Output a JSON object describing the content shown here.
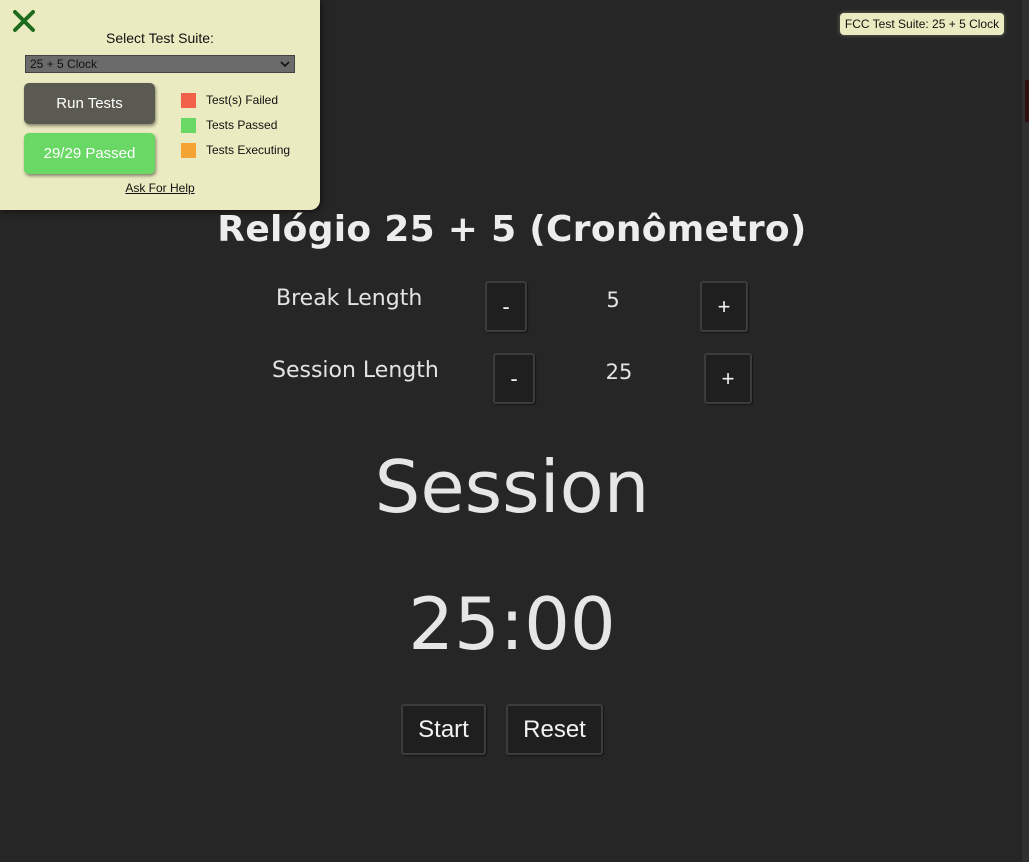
{
  "fcc_panel": {
    "close_icon": "close-x-icon",
    "select_label": "Select Test Suite:",
    "selected_suite": "25 + 5 Clock",
    "run_tests_label": "Run Tests",
    "passed_label": "29/29 Passed",
    "tests_passed": 29,
    "tests_total": 29,
    "legend": [
      {
        "label": "Test(s) Failed",
        "color": "#f2624b"
      },
      {
        "label": "Tests Passed",
        "color": "#6ad865"
      },
      {
        "label": "Tests Executing",
        "color": "#f5a333"
      }
    ],
    "help_link": "Ask For Help"
  },
  "fcc_badge": "FCC Test Suite: 25 + 5 Clock",
  "clock": {
    "title": "Relógio 25 + 5 (Cronômetro)",
    "break": {
      "label": "Break Length",
      "value": "5",
      "decrement": "-",
      "increment": "+"
    },
    "session": {
      "label": "Session Length",
      "value": "25",
      "decrement": "-",
      "increment": "+"
    },
    "timer_label": "Session",
    "time_left": "25:00",
    "start_label": "Start",
    "reset_label": "Reset"
  },
  "colors": {
    "background": "#262626",
    "panel": "#ebebc1",
    "run_button": "#5a5a50",
    "passed_button": "#6ad865",
    "close_icon": "#1e6b1e"
  }
}
